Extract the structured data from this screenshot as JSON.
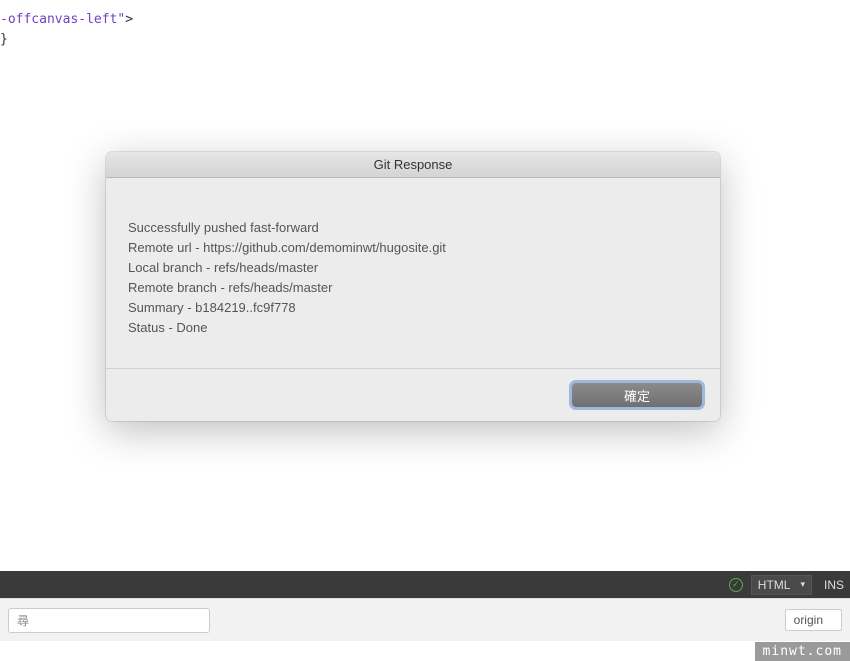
{
  "code": {
    "line1_attr": "-offcanvas-left\"",
    "line1_punc": ">",
    "line2": "}"
  },
  "dialog": {
    "title": "Git Response",
    "lines": [
      "Successfully pushed fast-forward",
      "Remote url - https://github.com/demominwt/hugosite.git",
      "Local branch - refs/heads/master",
      "Remote branch - refs/heads/master",
      "Summary - b184219..fc9f778",
      "Status - Done"
    ],
    "ok_label": "確定"
  },
  "statusbar": {
    "check_icon": "✓",
    "language": "HTML",
    "ins": "INS"
  },
  "bottombar": {
    "search_placeholder": "尋",
    "remote": "origin"
  },
  "watermark": "minwt.com"
}
